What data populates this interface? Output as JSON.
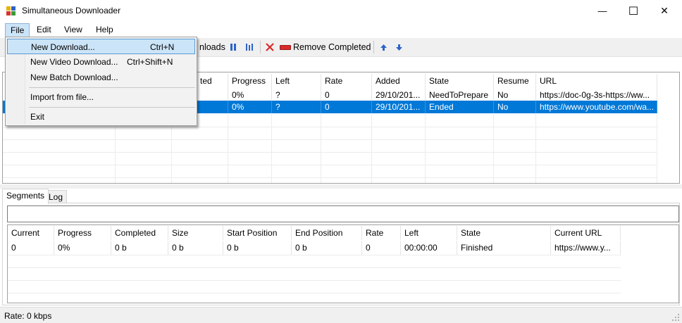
{
  "window": {
    "title": "Simultaneous Downloader",
    "minimize_glyph": "—",
    "maximize_glyph": "☐",
    "close_glyph": "✕"
  },
  "menubar": {
    "items": [
      "File",
      "Edit",
      "View",
      "Help"
    ]
  },
  "file_menu": {
    "items": [
      {
        "label": "New Download...",
        "shortcut": "Ctrl+N"
      },
      {
        "label": "New Video Download...",
        "shortcut": "Ctrl+Shift+N"
      },
      {
        "label": "New Batch Download...",
        "shortcut": ""
      },
      {
        "label": "Import from file...",
        "shortcut": ""
      },
      {
        "label": "Exit",
        "shortcut": ""
      }
    ]
  },
  "toolbar": {
    "downloads_partial": "nloads",
    "remove_completed": "Remove Completed",
    "icons": [
      "start-all-icon",
      "pause-all-icon",
      "remove-icon",
      "remove-completed-icon",
      "move-up-icon",
      "move-down-icon"
    ]
  },
  "downloads_grid": {
    "columns": [
      "Progress",
      "Left",
      "Rate",
      "Added",
      "State",
      "Resume",
      "URL"
    ],
    "completed_partial": "ted",
    "rows": [
      {
        "progress": "0%",
        "left": "?",
        "rate": "0",
        "added": "29/10/201...",
        "state": "NeedToPrepare",
        "resume": "No",
        "url": "https://doc-0g-3s-https://ww...",
        "selected": false
      },
      {
        "progress": "0%",
        "left": "?",
        "rate": "0",
        "added": "29/10/201...",
        "state": "Ended",
        "resume": "No",
        "url": "https://www.youtube.com/wa...",
        "selected": true
      }
    ]
  },
  "tabs": {
    "items": [
      "Segments",
      "Log"
    ],
    "active": "Segments"
  },
  "segments_grid": {
    "columns": [
      "Current",
      "Progress",
      "Completed",
      "Size",
      "Start Position",
      "End Position",
      "Rate",
      "Left",
      "State",
      "Current URL"
    ],
    "rows": [
      [
        "0",
        "0%",
        "0 b",
        "0 b",
        "0 b",
        "0 b",
        "0",
        "00:00:00",
        "Finished",
        "https://www.y..."
      ]
    ]
  },
  "status": {
    "label": "Rate:",
    "value": "0 kbps"
  },
  "colors": {
    "selection": "#0078d7",
    "menu_highlight": "#cce4f7",
    "remove_icon": "#d92b2b",
    "arrow_icon": "#2c64c8"
  }
}
